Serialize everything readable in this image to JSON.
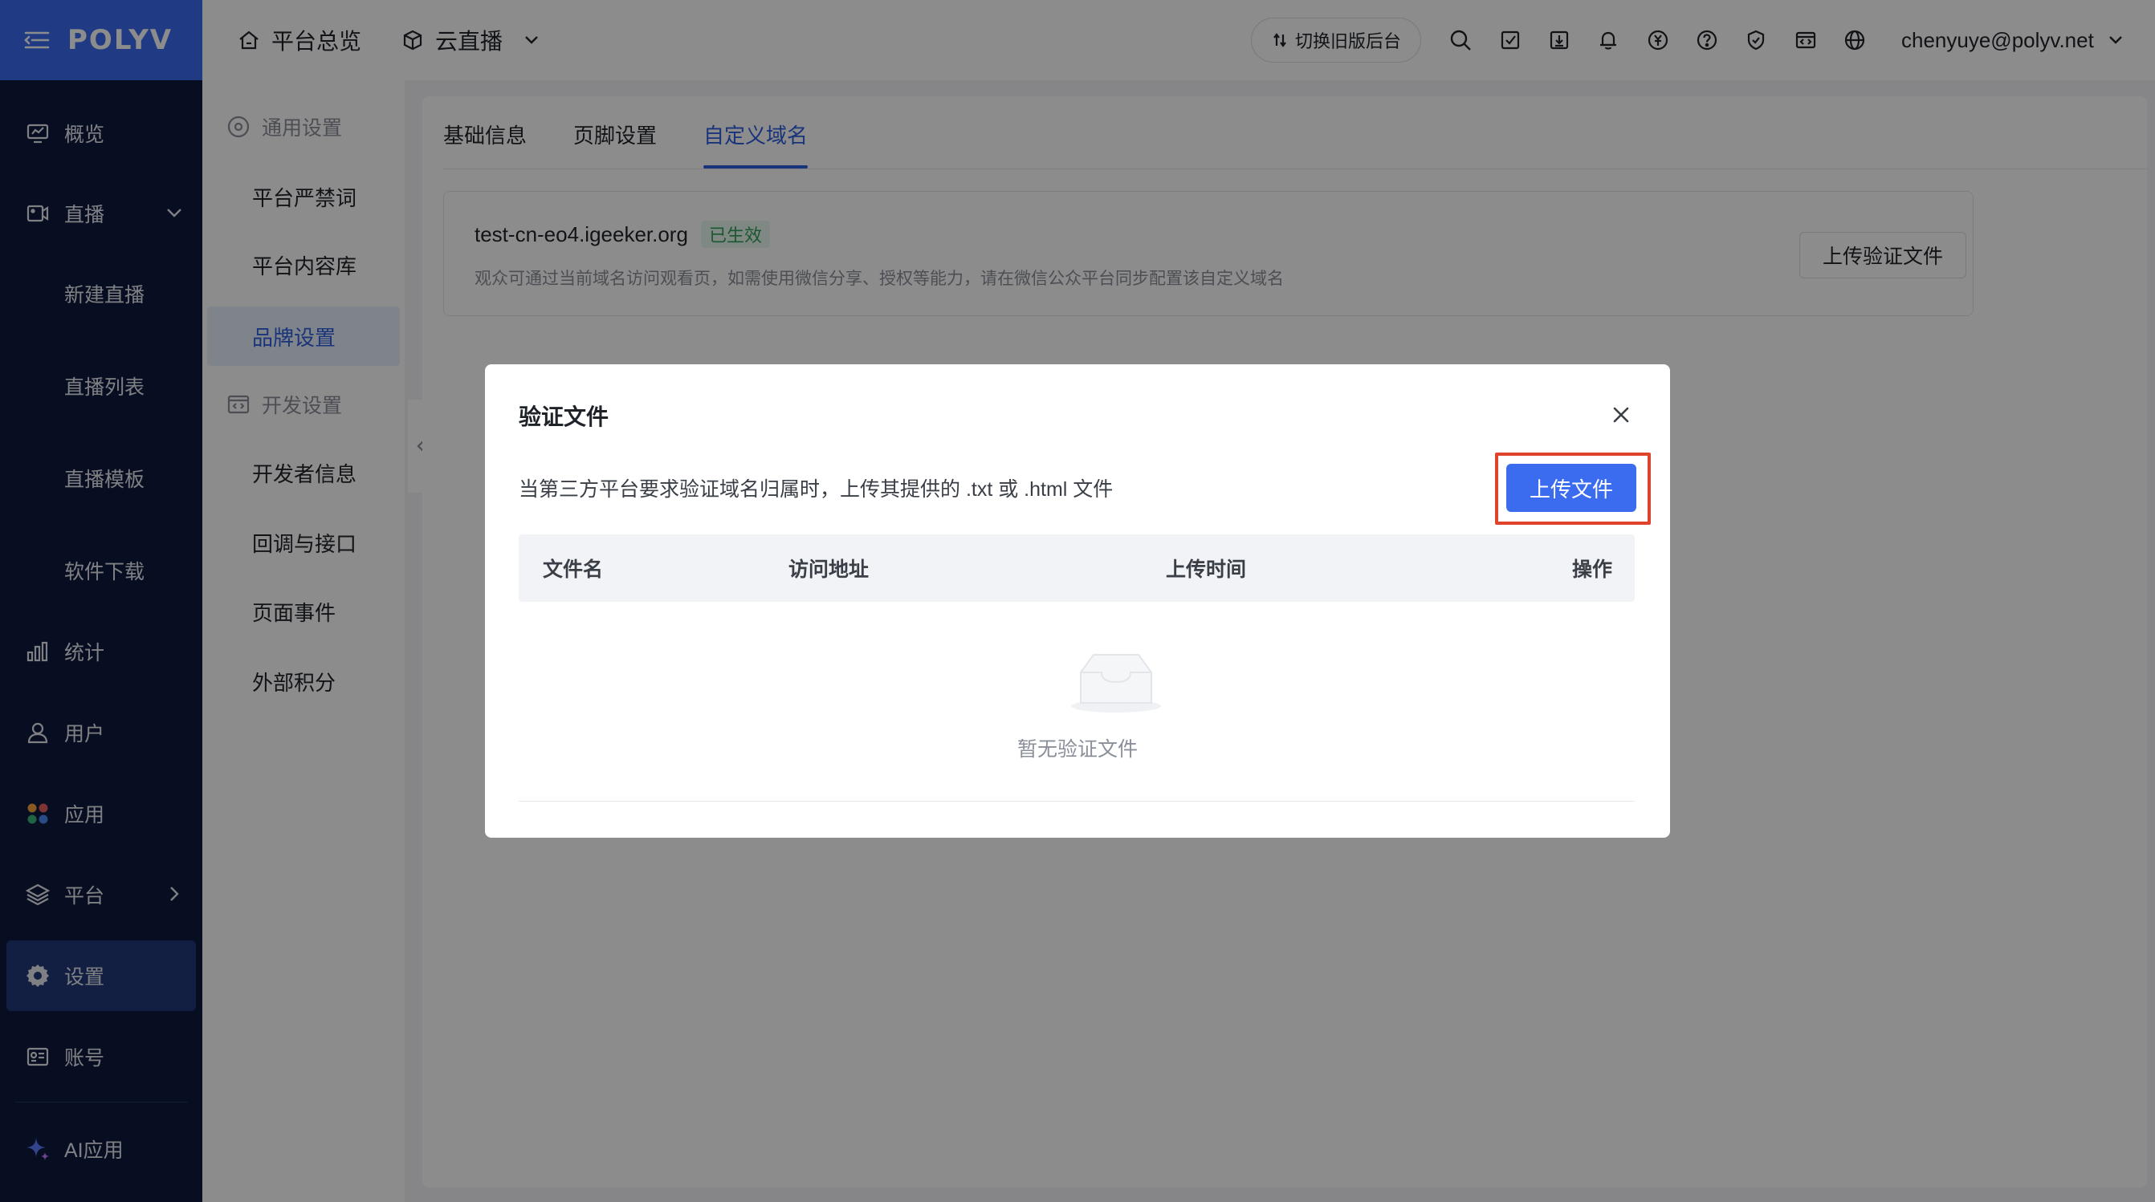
{
  "brand": {
    "logo": "POLYV",
    "accent": "#3b6cf0",
    "sidebar_bg": "#0e1a3c"
  },
  "sidebar": {
    "items": [
      {
        "label": "概览",
        "icon": "monitor-icon"
      },
      {
        "label": "直播",
        "icon": "camera-icon"
      },
      {
        "label": "新建直播"
      },
      {
        "label": "直播列表"
      },
      {
        "label": "直播模板"
      },
      {
        "label": "软件下载"
      },
      {
        "label": "统计",
        "icon": "bar-chart-icon"
      },
      {
        "label": "用户",
        "icon": "user-icon"
      },
      {
        "label": "应用",
        "icon": "apps-icon"
      },
      {
        "label": "平台",
        "icon": "layers-icon"
      },
      {
        "label": "设置",
        "icon": "gear-icon"
      },
      {
        "label": "账号",
        "icon": "id-card-icon"
      },
      {
        "label": "AI应用",
        "icon": "sparkle-icon"
      }
    ]
  },
  "topbar": {
    "home_label": "平台总览",
    "product_label": "云直播",
    "switch_label": "切换旧版后台",
    "user_email": "chenyuye@polyv.net"
  },
  "subnav": {
    "groups": [
      {
        "label": "通用设置",
        "items": [
          "平台严禁词",
          "平台内容库",
          "品牌设置"
        ]
      },
      {
        "label": "开发设置",
        "items": [
          "开发者信息",
          "回调与接口",
          "页面事件",
          "外部积分"
        ]
      }
    ],
    "active": "品牌设置"
  },
  "main": {
    "tabs": [
      "基础信息",
      "页脚设置",
      "自定义域名"
    ],
    "active_tab": "自定义域名",
    "domain": {
      "name": "test-cn-eo4.igeeker.org",
      "status": "已生效",
      "description": "观众可通过当前域名访问观看页，如需使用微信分享、授权等能力，请在微信公众平台同步配置该自定义域名",
      "upload_button": "上传验证文件"
    }
  },
  "modal": {
    "title": "验证文件",
    "hint": "当第三方平台要求验证域名归属时，上传其提供的 .txt 或 .html 文件",
    "upload_button": "上传文件",
    "columns": [
      "文件名",
      "访问地址",
      "上传时间",
      "操作"
    ],
    "empty_text": "暂无验证文件"
  }
}
